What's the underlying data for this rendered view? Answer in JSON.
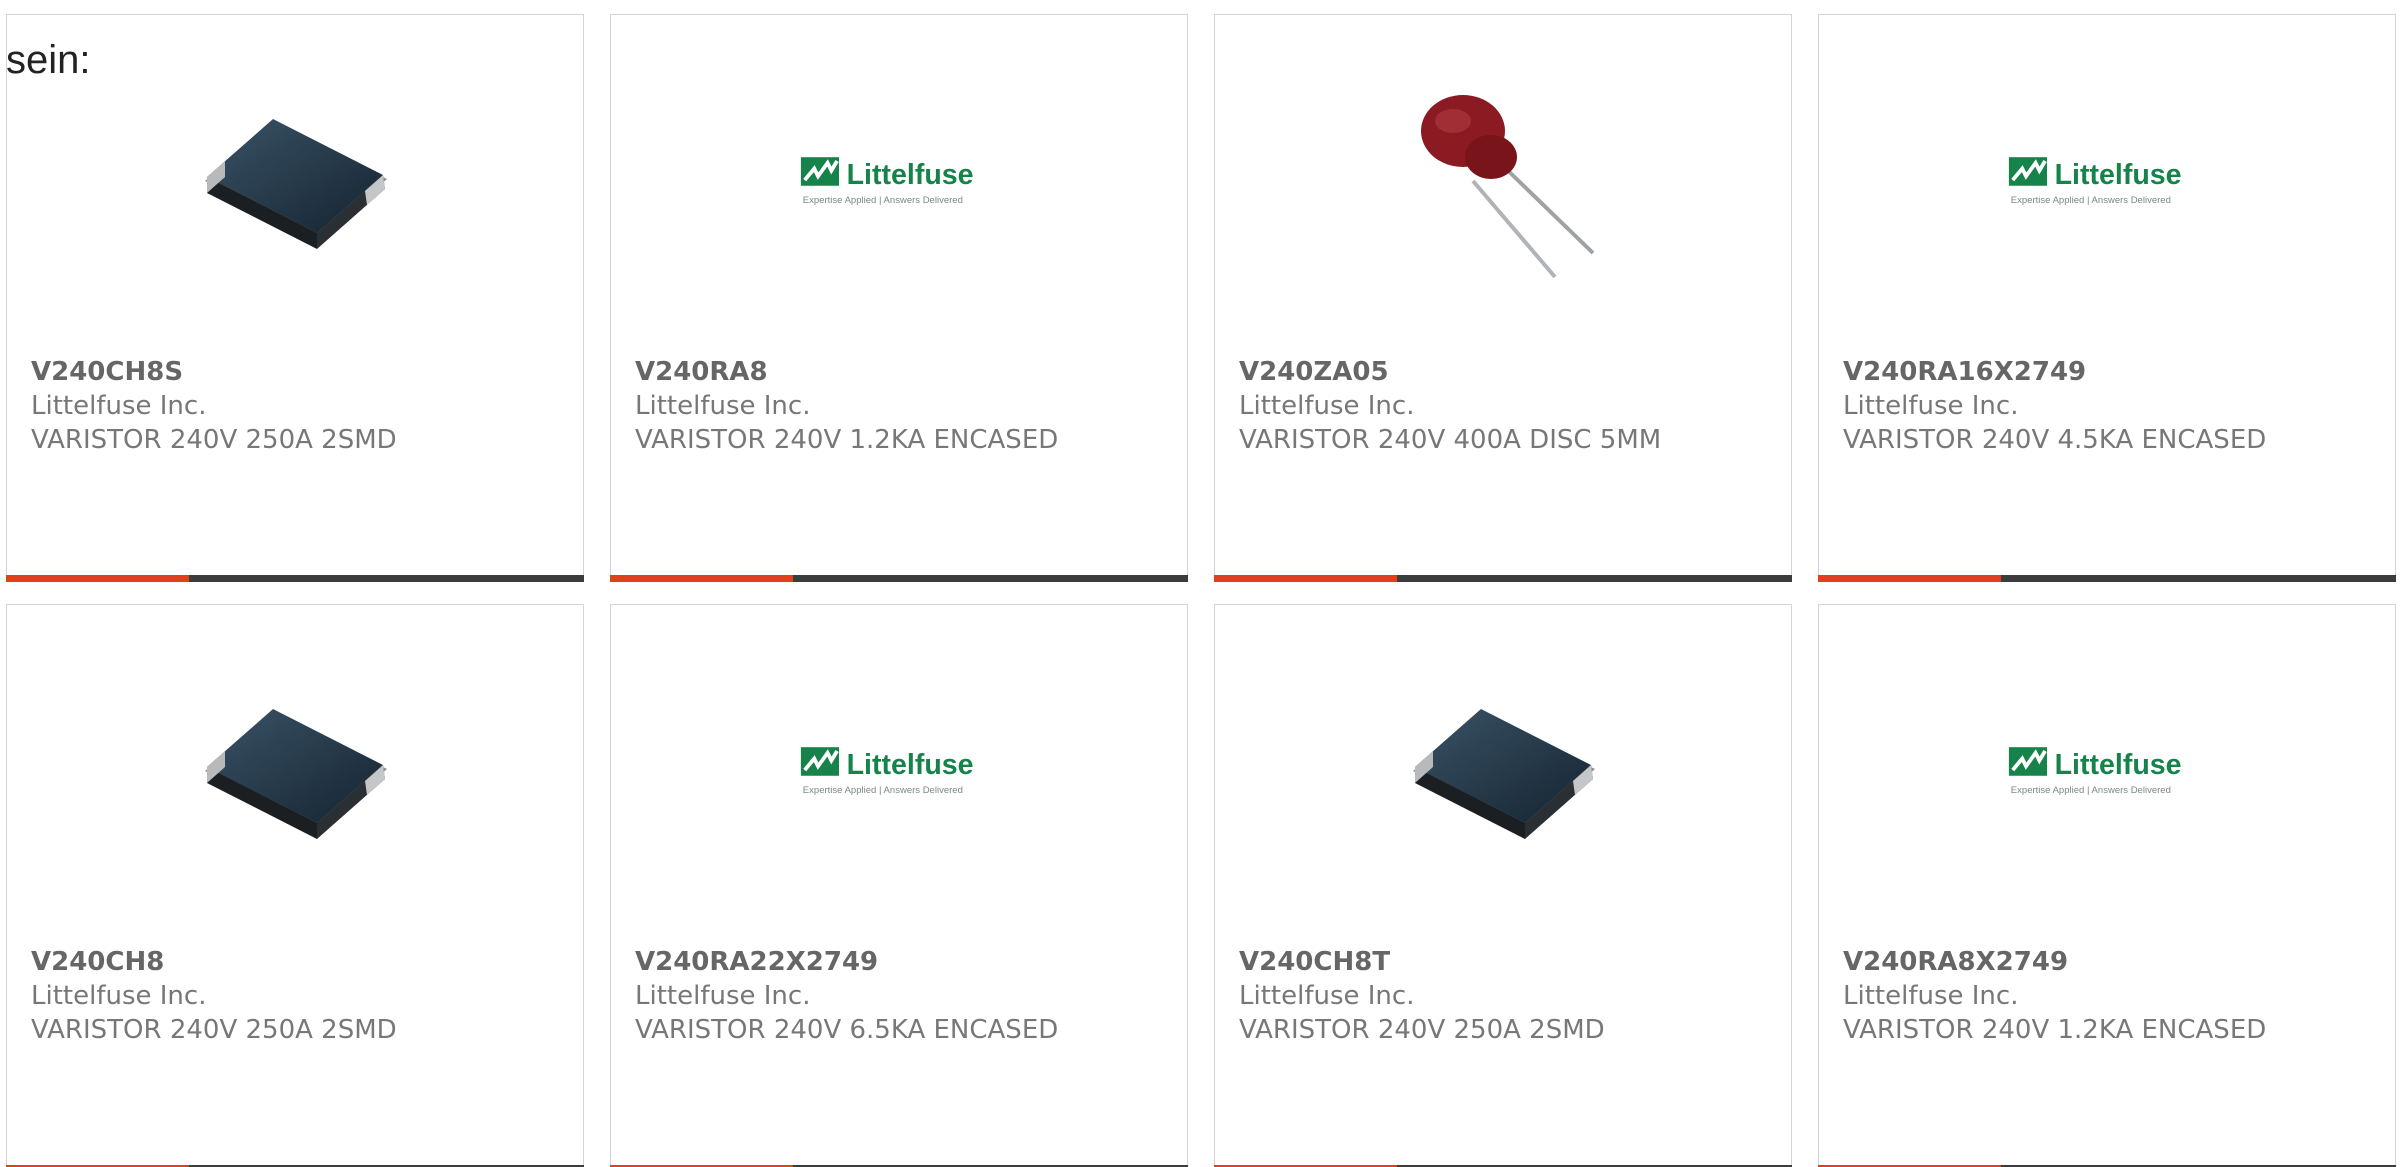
{
  "intro_text": "sein:",
  "colors": {
    "accent": "#e0411a",
    "bar": "#3c3c3c",
    "brand_green": "#16844a"
  },
  "logo_text": {
    "brand": "Littelfuse",
    "tagline": "Expertise Applied | Answers Delivered"
  },
  "products": [
    {
      "part_number": "V240CH8S",
      "manufacturer": "Littelfuse Inc.",
      "description": "VARISTOR 240V 250A 2SMD",
      "image": "smd-varistor-icon"
    },
    {
      "part_number": "V240RA8",
      "manufacturer": "Littelfuse Inc.",
      "description": "VARISTOR 240V 1.2KA ENCASED",
      "image": "littelfuse-logo"
    },
    {
      "part_number": "V240ZA05",
      "manufacturer": "Littelfuse Inc.",
      "description": "VARISTOR 240V 400A DISC 5MM",
      "image": "disc-varistor-icon"
    },
    {
      "part_number": "V240RA16X2749",
      "manufacturer": "Littelfuse Inc.",
      "description": "VARISTOR 240V 4.5KA ENCASED",
      "image": "littelfuse-logo"
    },
    {
      "part_number": "V240CH8",
      "manufacturer": "Littelfuse Inc.",
      "description": "VARISTOR 240V 250A 2SMD",
      "image": "smd-varistor-icon"
    },
    {
      "part_number": "V240RA22X2749",
      "manufacturer": "Littelfuse Inc.",
      "description": "VARISTOR 240V 6.5KA ENCASED",
      "image": "littelfuse-logo"
    },
    {
      "part_number": "V240CH8T",
      "manufacturer": "Littelfuse Inc.",
      "description": "VARISTOR 240V 250A 2SMD",
      "image": "smd-varistor-icon"
    },
    {
      "part_number": "V240RA8X2749",
      "manufacturer": "Littelfuse Inc.",
      "description": "VARISTOR 240V 1.2KA ENCASED",
      "image": "littelfuse-logo"
    }
  ]
}
